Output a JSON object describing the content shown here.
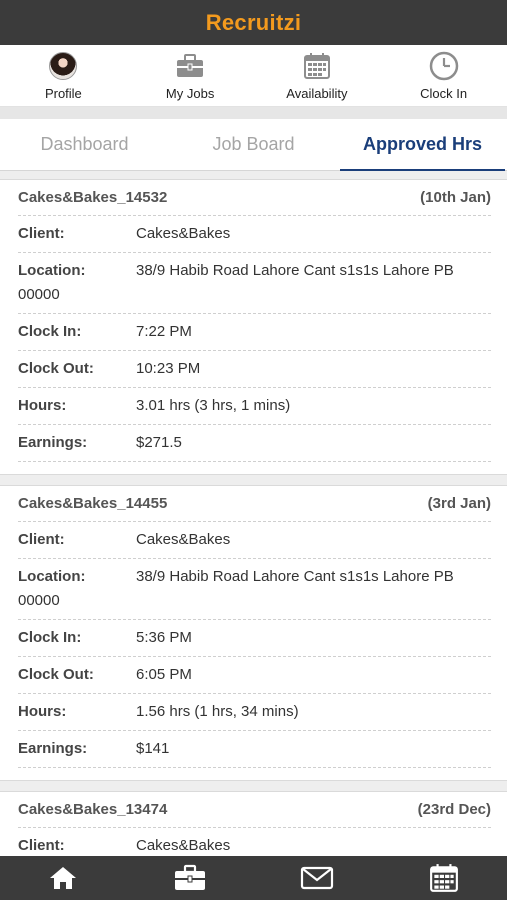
{
  "app": {
    "title": "Recruitzi"
  },
  "nav": {
    "profile": "Profile",
    "my_jobs": "My Jobs",
    "availability": "Availability",
    "clock_in": "Clock In"
  },
  "tabs": {
    "dashboard": "Dashboard",
    "job_board": "Job Board",
    "approved_hrs": "Approved Hrs"
  },
  "labels": {
    "client": "Client:",
    "location": "Location:",
    "clock_in": "Clock In:",
    "clock_out": "Clock Out:",
    "hours": "Hours:",
    "earnings": "Earnings:"
  },
  "records": [
    {
      "id": "Cakes&Bakes_14532",
      "date": "(10th Jan)",
      "client": "Cakes&Bakes",
      "location": "38/9 Habib Road Lahore Cant s1s1s Lahore PB 00000",
      "clock_in": "7:22 PM",
      "clock_out": "10:23 PM",
      "hours": "3.01 hrs (3 hrs, 1 mins)",
      "earnings": "$271.5"
    },
    {
      "id": "Cakes&Bakes_14455",
      "date": "(3rd Jan)",
      "client": "Cakes&Bakes",
      "location": "38/9 Habib Road Lahore Cant s1s1s Lahore PB 00000",
      "clock_in": "5:36 PM",
      "clock_out": "6:05 PM",
      "hours": "1.56 hrs (1 hrs, 34 mins)",
      "earnings": "$141"
    },
    {
      "id": "Cakes&Bakes_13474",
      "date": "(23rd Dec)",
      "client": "Cakes&Bakes"
    }
  ],
  "colors": {
    "accent": "#f39a1e",
    "active_tab": "#1a3e7a",
    "bar": "#3b3b3b"
  }
}
